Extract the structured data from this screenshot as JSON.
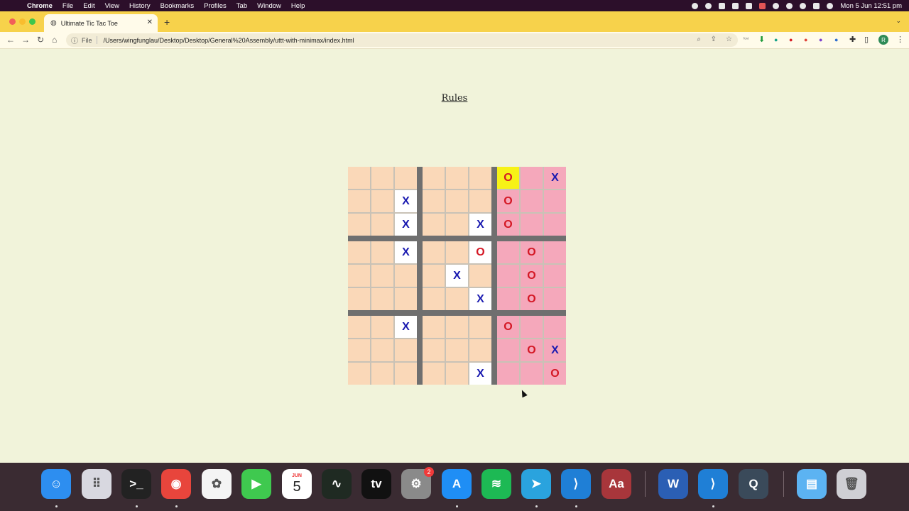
{
  "menubar": {
    "app": "Chrome",
    "items": [
      "File",
      "Edit",
      "View",
      "History",
      "Bookmarks",
      "Profiles",
      "Tab",
      "Window",
      "Help"
    ],
    "datetime": "Mon 5 Jun  12:51 pm"
  },
  "browser": {
    "tab_title": "Ultimate Tic Tac Toe",
    "url_scheme": "File",
    "url": "/Users/wingfunglau/Desktop/Desktop/General%20Assembly/uttt-with-minimax/index.html"
  },
  "page": {
    "rules_link": "Rules"
  },
  "board": {
    "marks": [
      [
        "",
        "",
        "",
        "",
        "",
        "",
        "O",
        "",
        "X"
      ],
      [
        "",
        "",
        "X",
        "",
        "",
        "",
        "O",
        "",
        ""
      ],
      [
        "",
        "",
        "X",
        "",
        "",
        "X",
        "O",
        "",
        ""
      ],
      [
        "",
        "",
        "X",
        "",
        "",
        "O",
        "",
        "O",
        ""
      ],
      [
        "",
        "",
        "",
        "",
        "X",
        "",
        "",
        "O",
        ""
      ],
      [
        "",
        "",
        "",
        "",
        "",
        "X",
        "",
        "O",
        ""
      ],
      [
        "",
        "",
        "X",
        "",
        "",
        "",
        "O",
        "",
        ""
      ],
      [
        "",
        "",
        "",
        "",
        "",
        "",
        "",
        "O",
        "X"
      ],
      [
        "",
        "",
        "",
        "",
        "",
        "X",
        "",
        "",
        "O"
      ]
    ],
    "won_subboards": {
      "0,2": "O",
      "1,2": "O",
      "2,2": "O"
    },
    "highlighted_cell": [
      0,
      6
    ],
    "colors": {
      "empty_cell": "#fad8b8",
      "won_o_cell": "#f5a8bb",
      "played_cell": "#ffffff",
      "highlight": "#f7f217",
      "x_mark": "#1a1ab0",
      "o_mark": "#d41825",
      "divider": "#6f6f6f"
    }
  },
  "dock": {
    "apps": [
      {
        "name": "finder-icon",
        "color": "#2d8ef0",
        "glyph": "☺"
      },
      {
        "name": "launchpad-icon",
        "color": "#d8d8e0",
        "glyph": "⠿"
      },
      {
        "name": "terminal-icon",
        "color": "#222222",
        "glyph": ">_"
      },
      {
        "name": "chrome-icon",
        "color": "#e8453c",
        "glyph": "◉"
      },
      {
        "name": "photos-icon",
        "color": "#f4f4f4",
        "glyph": "✿"
      },
      {
        "name": "facetime-icon",
        "color": "#3fc94f",
        "glyph": "▶"
      },
      {
        "name": "calendar-icon",
        "color": "#ffffff",
        "glyph": "5"
      },
      {
        "name": "activity-monitor-icon",
        "color": "#1f2a22",
        "glyph": "∿"
      },
      {
        "name": "apple-tv-icon",
        "color": "#111111",
        "glyph": "tv"
      },
      {
        "name": "system-settings-icon",
        "color": "#8a8a8a",
        "glyph": "⚙"
      },
      {
        "name": "app-store-icon",
        "color": "#1f8ef5",
        "glyph": "A"
      },
      {
        "name": "spotify-icon",
        "color": "#1db954",
        "glyph": "≋"
      },
      {
        "name": "telegram-icon",
        "color": "#2aa3de",
        "glyph": "➤"
      },
      {
        "name": "vscode-icon",
        "color": "#1f7fd6",
        "glyph": "⟩"
      },
      {
        "name": "dictionary-icon",
        "color": "#a8363b",
        "glyph": "Aa"
      },
      {
        "name": "word-icon",
        "color": "#2b5fb4",
        "glyph": "W"
      },
      {
        "name": "vscode-2-icon",
        "color": "#1f7fd6",
        "glyph": "⟩"
      },
      {
        "name": "quicktime-icon",
        "color": "#3a4a5a",
        "glyph": "Q"
      },
      {
        "name": "downloads-folder-icon",
        "color": "#5cb3f2",
        "glyph": "▤"
      },
      {
        "name": "trash-icon",
        "color": "#cfcfd4",
        "glyph": "🗑"
      }
    ],
    "calendar_month": "JUN",
    "settings_badge": "2"
  }
}
